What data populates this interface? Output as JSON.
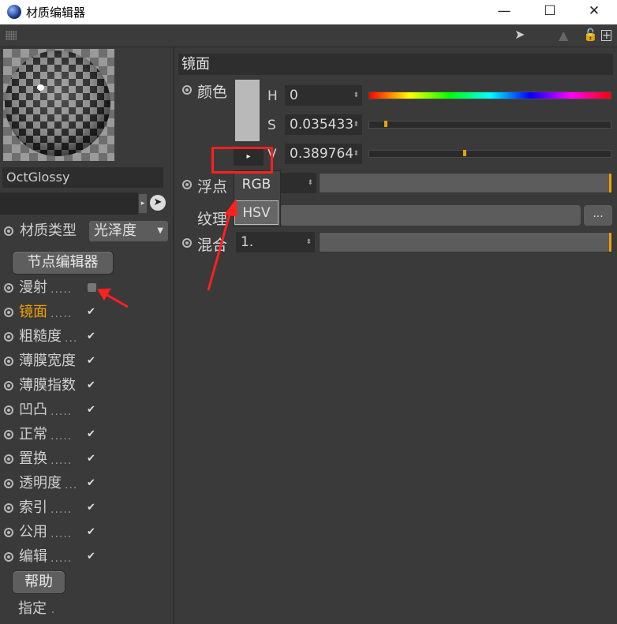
{
  "window": {
    "title": "材质编辑器",
    "minimize": "—",
    "maximize": "☐",
    "close": "✕"
  },
  "toolbar": {
    "icons": [
      "back-arrow-icon",
      "forward-arrow-icon",
      "up-arrow-icon",
      "lock-icon",
      "add-panel-icon"
    ]
  },
  "left": {
    "material_name": "OctGlossy",
    "material_type_label": "材质类型",
    "material_type_value": "光泽度",
    "node_editor_button": "节点编辑器",
    "channels": [
      {
        "label": "漫射",
        "dots": ".....",
        "checked": false,
        "active": false
      },
      {
        "label": "镜面",
        "dots": ".....",
        "checked": true,
        "active": true
      },
      {
        "label": "粗糙度",
        "dots": "...",
        "checked": true,
        "active": false
      },
      {
        "label": "薄膜宽度",
        "dots": "",
        "checked": true,
        "active": false
      },
      {
        "label": "薄膜指数",
        "dots": "",
        "checked": true,
        "active": false
      },
      {
        "label": "凹凸",
        "dots": ".....",
        "checked": true,
        "active": false
      },
      {
        "label": "正常",
        "dots": ".....",
        "checked": true,
        "active": false
      },
      {
        "label": "置换",
        "dots": ".....",
        "checked": true,
        "active": false
      },
      {
        "label": "透明度",
        "dots": "...",
        "checked": true,
        "active": false
      },
      {
        "label": "索引",
        "dots": ".....",
        "checked": true,
        "active": false
      },
      {
        "label": "公用",
        "dots": ".....",
        "checked": true,
        "active": false
      },
      {
        "label": "编辑",
        "dots": ".....",
        "checked": true,
        "active": false
      }
    ],
    "help_button": "帮助",
    "assign_label": "指定",
    "assign_dots": "."
  },
  "right": {
    "section_title": "镜面",
    "color_label": "颜色",
    "h_label": "H",
    "h_value": "0",
    "s_label": "S",
    "s_value": "0.035433",
    "v_label": "V",
    "v_value": "0.389764",
    "s_fraction": 0.035433,
    "v_fraction": 0.389764,
    "float_label": "浮点",
    "texture_label": "纹理",
    "texture_more": "...",
    "mix_label": "混合",
    "mix_value": "1.",
    "color_mode_menu": [
      "RGB",
      "HSV"
    ],
    "color_mode_selected": "HSV",
    "expander_icon": "▸"
  },
  "colors": {
    "accent_orange": "#f0a000",
    "annotation_red": "#ff2020",
    "swatch": "#b9b9b9"
  }
}
